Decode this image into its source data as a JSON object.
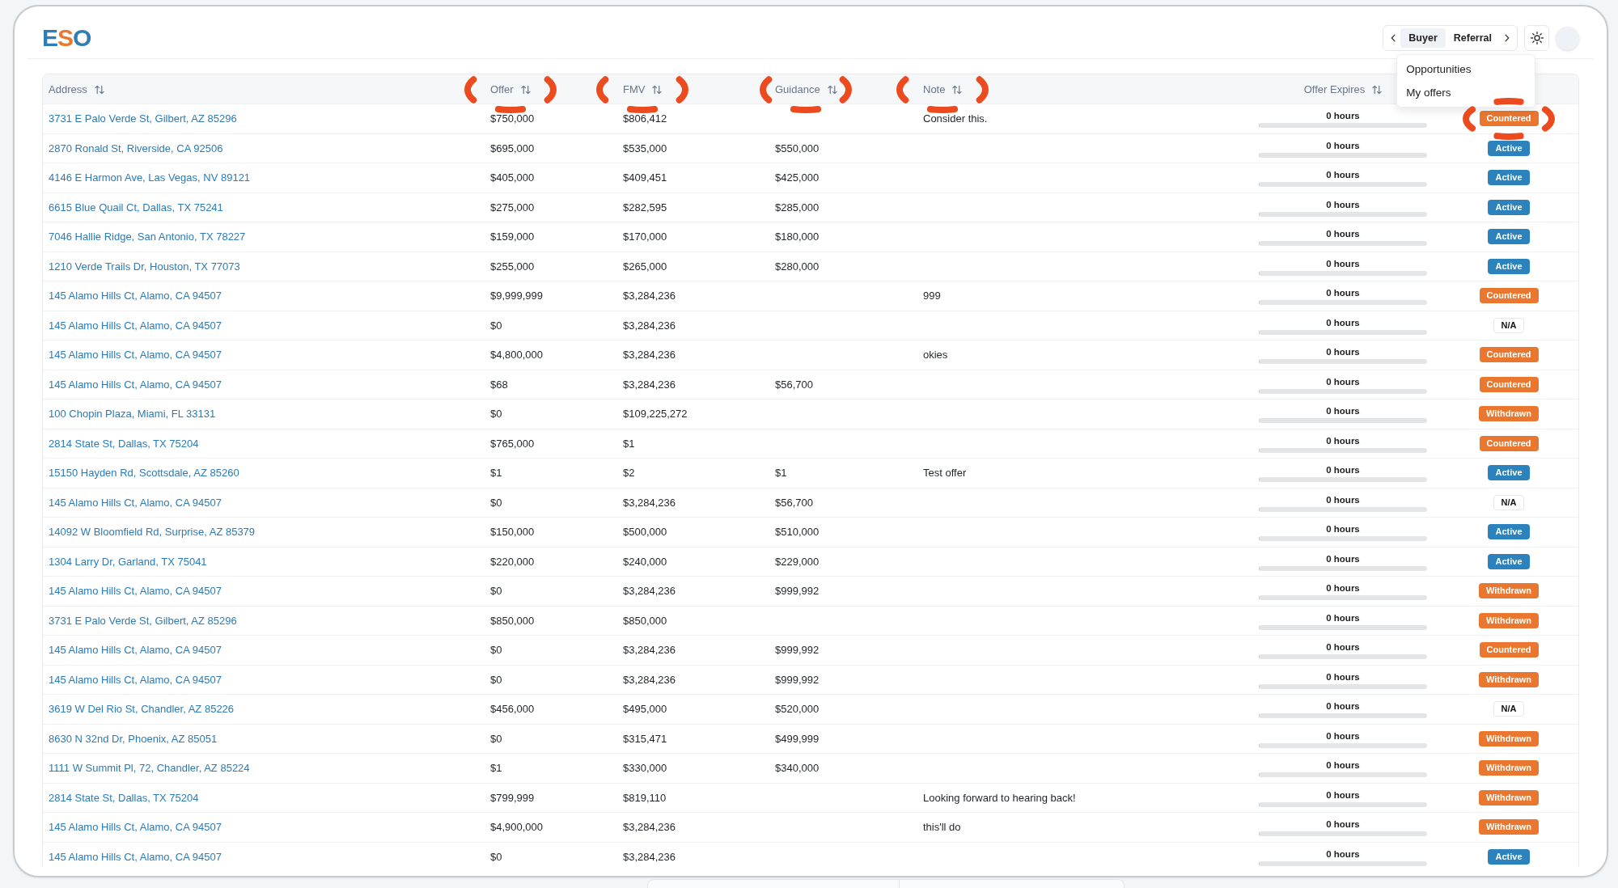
{
  "header": {
    "logo": [
      {
        "char": "E",
        "color": "#2e7db5"
      },
      {
        "char": "S",
        "color": "#e9782f"
      },
      {
        "char": "O",
        "color": "#2e7db5"
      }
    ],
    "tabs": [
      {
        "label": "Buyer",
        "selected": true
      },
      {
        "label": "Referral",
        "selected": false
      }
    ],
    "menu": [
      {
        "label": "Opportunities"
      },
      {
        "label": "My offers"
      }
    ]
  },
  "table": {
    "columns": [
      {
        "label": "Address",
        "sortable": true,
        "circled": false
      },
      {
        "label": "Offer",
        "sortable": true,
        "circled": true
      },
      {
        "label": "FMV",
        "sortable": true,
        "circled": true
      },
      {
        "label": "Guidance",
        "sortable": true,
        "circled": true
      },
      {
        "label": "Note",
        "sortable": true,
        "circled": true
      },
      {
        "label": "Offer Expires",
        "sortable": true,
        "circled": false
      },
      {
        "sortable": false,
        "circled": false
      }
    ],
    "rows": [
      {
        "address": "3731 E Palo Verde St, Gilbert, AZ 85296",
        "offer": "$750,000",
        "fmv": "$806,412",
        "note": "Consider this.",
        "expires": "0 hours",
        "level": 0,
        "status": "Countered",
        "kind": "countered",
        "circled": true
      },
      {
        "address": "2870 Ronald St, Riverside, CA 92506",
        "offer": "$695,000",
        "fmv": "$535,000",
        "guidance": "$550,000",
        "expires": "0 hours",
        "level": 0,
        "status": "Active",
        "kind": "active",
        "circled": false
      },
      {
        "address": "4146 E Harmon Ave, Las Vegas, NV 89121",
        "offer": "$405,000",
        "fmv": "$409,451",
        "guidance": "$425,000",
        "expires": "0 hours",
        "level": 0,
        "status": "Active",
        "kind": "active",
        "circled": false
      },
      {
        "address": "6615 Blue Quail Ct, Dallas, TX 75241",
        "offer": "$275,000",
        "fmv": "$282,595",
        "guidance": "$285,000",
        "expires": "0 hours",
        "level": 0,
        "status": "Active",
        "kind": "active",
        "circled": false
      },
      {
        "address": "7046 Hallie Ridge, San Antonio, TX 78227",
        "offer": "$159,000",
        "fmv": "$170,000",
        "guidance": "$180,000",
        "expires": "0 hours",
        "level": 0,
        "status": "Active",
        "kind": "active",
        "circled": false
      },
      {
        "address": "1210 Verde Trails Dr, Houston, TX 77073",
        "offer": "$255,000",
        "fmv": "$265,000",
        "guidance": "$280,000",
        "expires": "0 hours",
        "level": 0,
        "status": "Active",
        "kind": "active",
        "circled": false
      },
      {
        "address": "145 Alamo Hills Ct, Alamo, CA 94507",
        "offer": "$9,999,999",
        "fmv": "$3,284,236",
        "note": "999",
        "expires": "0 hours",
        "level": 0,
        "status": "Countered",
        "kind": "countered",
        "circled": false
      },
      {
        "address": "145 Alamo Hills Ct, Alamo, CA 94507",
        "offer": "$0",
        "fmv": "$3,284,236",
        "expires": "0 hours",
        "level": 0,
        "status": "N/A",
        "kind": "na",
        "circled": false
      },
      {
        "address": "145 Alamo Hills Ct, Alamo, CA 94507",
        "offer": "$4,800,000",
        "fmv": "$3,284,236",
        "note": "okies",
        "expires": "0 hours",
        "level": 0,
        "status": "Countered",
        "kind": "countered",
        "circled": false
      },
      {
        "address": "145 Alamo Hills Ct, Alamo, CA 94507",
        "offer": "$68",
        "fmv": "$3,284,236",
        "guidance": "$56,700",
        "expires": "0 hours",
        "level": 0,
        "status": "Countered",
        "kind": "countered",
        "circled": false
      },
      {
        "address": "100 Chopin Plaza, Miami, FL 33131",
        "offer": "$0",
        "fmv": "$109,225,272",
        "expires": "0 hours",
        "level": 0,
        "status": "Withdrawn",
        "kind": "withdrawn",
        "circled": false
      },
      {
        "address": "2814 State St, Dallas, TX 75204",
        "offer": "$765,000",
        "fmv": "$1",
        "expires": "0 hours",
        "level": 0,
        "status": "Countered",
        "kind": "countered",
        "circled": false
      },
      {
        "address": "15150 Hayden Rd, Scottsdale, AZ 85260",
        "offer": "$1",
        "fmv": "$2",
        "guidance": "$1",
        "note": "Test offer",
        "expires": "0 hours",
        "level": 0,
        "status": "Active",
        "kind": "active",
        "circled": false
      },
      {
        "address": "145 Alamo Hills Ct, Alamo, CA 94507",
        "offer": "$0",
        "fmv": "$3,284,236",
        "guidance": "$56,700",
        "expires": "0 hours",
        "level": 0,
        "status": "N/A",
        "kind": "na",
        "circled": false
      },
      {
        "address": "14092 W Bloomfield Rd, Surprise, AZ 85379",
        "offer": "$150,000",
        "fmv": "$500,000",
        "guidance": "$510,000",
        "expires": "0 hours",
        "level": 0,
        "status": "Active",
        "kind": "active",
        "circled": false
      },
      {
        "address": "1304 Larry Dr, Garland, TX 75041",
        "offer": "$220,000",
        "fmv": "$240,000",
        "guidance": "$229,000",
        "expires": "0 hours",
        "level": 0,
        "status": "Active",
        "kind": "active",
        "circled": false
      },
      {
        "address": "145 Alamo Hills Ct, Alamo, CA 94507",
        "offer": "$0",
        "fmv": "$3,284,236",
        "guidance": "$999,992",
        "expires": "0 hours",
        "level": 0,
        "status": "Withdrawn",
        "kind": "withdrawn",
        "circled": false
      },
      {
        "address": "3731 E Palo Verde St, Gilbert, AZ 85296",
        "offer": "$850,000",
        "fmv": "$850,000",
        "expires": "0 hours",
        "level": 0,
        "status": "Withdrawn",
        "kind": "withdrawn",
        "circled": false
      },
      {
        "address": "145 Alamo Hills Ct, Alamo, CA 94507",
        "offer": "$0",
        "fmv": "$3,284,236",
        "guidance": "$999,992",
        "expires": "0 hours",
        "level": 0,
        "status": "Countered",
        "kind": "countered",
        "circled": false
      },
      {
        "address": "145 Alamo Hills Ct, Alamo, CA 94507",
        "offer": "$0",
        "fmv": "$3,284,236",
        "guidance": "$999,992",
        "expires": "0 hours",
        "level": 0,
        "status": "Withdrawn",
        "kind": "withdrawn",
        "circled": false
      },
      {
        "address": "3619 W Del Rio St, Chandler, AZ 85226",
        "offer": "$456,000",
        "fmv": "$495,000",
        "guidance": "$520,000",
        "expires": "0 hours",
        "level": 0,
        "status": "N/A",
        "kind": "na",
        "circled": false
      },
      {
        "address": "8630 N 32nd Dr, Phoenix, AZ 85051",
        "offer": "$0",
        "fmv": "$315,471",
        "guidance": "$499,999",
        "expires": "0 hours",
        "level": 0,
        "status": "Withdrawn",
        "kind": "withdrawn",
        "circled": false
      },
      {
        "address": "1111 W Summit Pl, 72, Chandler, AZ 85224",
        "offer": "$1",
        "fmv": "$330,000",
        "guidance": "$340,000",
        "expires": "0 hours",
        "level": 0,
        "status": "Withdrawn",
        "kind": "withdrawn",
        "circled": false
      },
      {
        "address": "2814 State St, Dallas, TX 75204",
        "offer": "$799,999",
        "fmv": "$819,110",
        "note": "Looking forward to hearing back!",
        "expires": "0 hours",
        "level": 0,
        "status": "Withdrawn",
        "kind": "withdrawn",
        "circled": false
      },
      {
        "address": "145 Alamo Hills Ct, Alamo, CA 94507",
        "offer": "$4,900,000",
        "fmv": "$3,284,236",
        "note": "this'll do",
        "expires": "0 hours",
        "level": 0,
        "status": "Withdrawn",
        "kind": "withdrawn",
        "circled": false
      },
      {
        "address": "145 Alamo Hills Ct, Alamo, CA 94507",
        "offer": "$0",
        "fmv": "$3,284,236",
        "expires": "0 hours",
        "level": 0,
        "status": "Active",
        "kind": "active",
        "circled": false
      }
    ]
  }
}
